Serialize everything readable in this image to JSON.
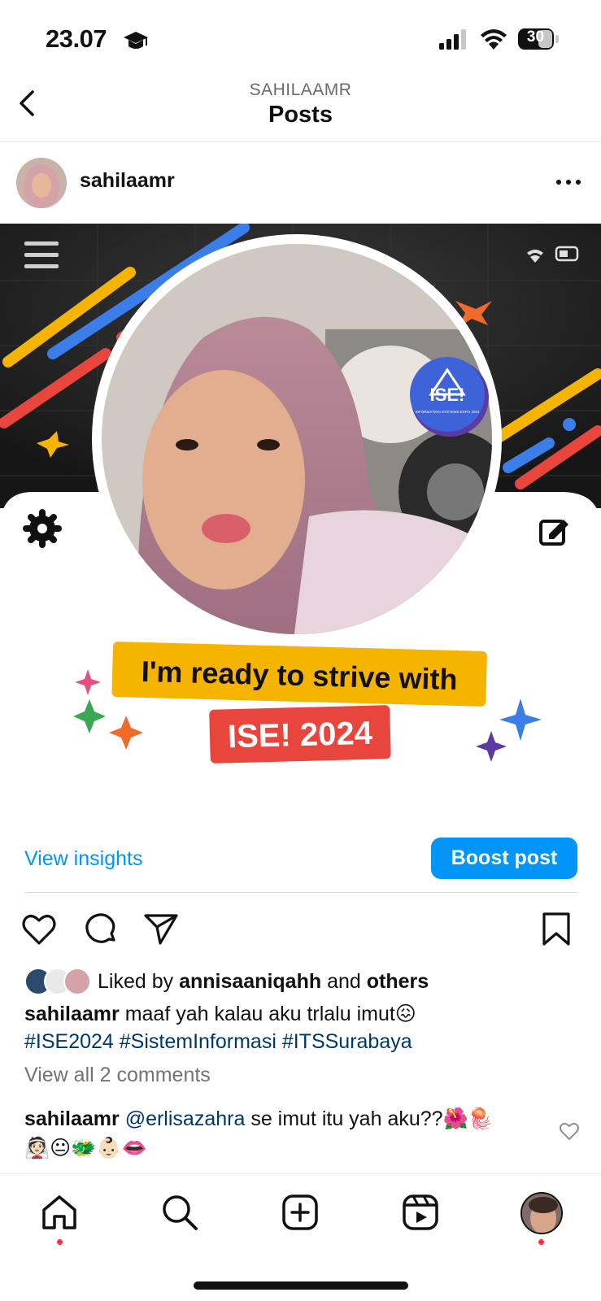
{
  "status_bar": {
    "time": "23.07",
    "battery": "30"
  },
  "header": {
    "subtitle": "SAHILAAMR",
    "title": "Posts"
  },
  "post": {
    "username": "sahilaamr",
    "image": {
      "banner_line1": "I'm ready to strive with",
      "banner_line2": "ISE! 2024",
      "badge_text": "ISE!",
      "badge_subtext": "INFORMATION SYSTEMS EXPO 2024"
    },
    "insights_label": "View insights",
    "boost_label": "Boost post",
    "likes": {
      "prefix": "Liked by",
      "user": "annisaaniqahh",
      "joiner": "and",
      "others": "others"
    },
    "caption": {
      "username": "sahilaamr",
      "text": "maaf yah kalau aku trlalu imut😖",
      "hashtags": "#ISE2024 #SistemInformasi #ITSSurabaya"
    },
    "view_comments": "View all 2 comments",
    "comment": {
      "username": "sahilaamr",
      "mention": "@erlisazahra",
      "text": "se imut itu yah aku??🌺🪼",
      "emojis": "👰🏻😐🐲👶🏻👄"
    }
  },
  "nav": [
    "home-icon",
    "search-icon",
    "create-icon",
    "reels-icon",
    "profile-avatar"
  ]
}
